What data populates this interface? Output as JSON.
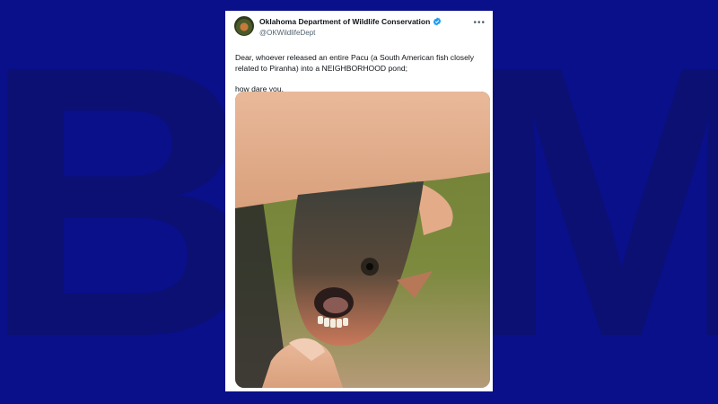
{
  "background": {
    "color": "#0a0f8a",
    "logo_text": "BFM"
  },
  "tweet": {
    "display_name": "Oklahoma Department of Wildlife Conservation",
    "handle": "@OKWildlifeDept",
    "verified": true,
    "text_line1": "Dear, whoever released an entire Pacu (a South American fish closely related to Piranha) into a NEIGHBORHOOD pond;",
    "text_line2": "how dare you.",
    "media_description": "hand holding a pacu fish with human-like teeth"
  },
  "colors": {
    "verified": "#1d9bf0",
    "text": "#0f1419",
    "secondary": "#536471"
  }
}
